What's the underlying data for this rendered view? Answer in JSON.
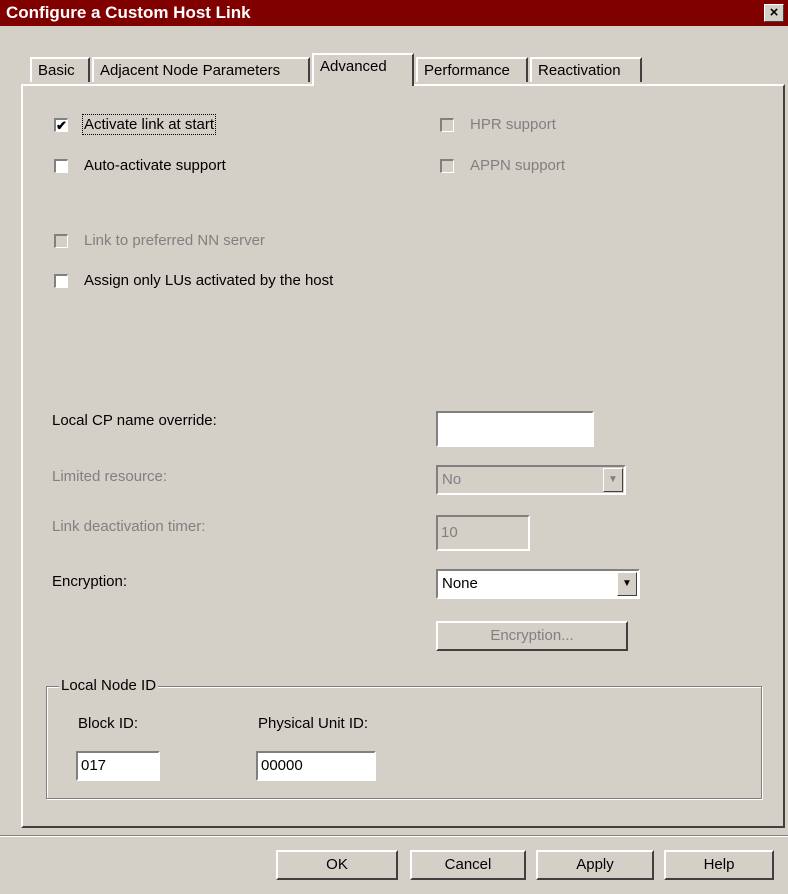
{
  "window": {
    "title": "Configure a Custom Host Link",
    "close_label": "×"
  },
  "tabs": [
    {
      "label": "Basic"
    },
    {
      "label": "Adjacent Node Parameters"
    },
    {
      "label": "Advanced"
    },
    {
      "label": "Performance"
    },
    {
      "label": "Reactivation"
    }
  ],
  "active_tab": "Advanced",
  "checkboxes": {
    "activate_link": {
      "label": "Activate link at start",
      "checked": true,
      "enabled": true
    },
    "auto_activate": {
      "label": "Auto-activate support",
      "checked": false,
      "enabled": true
    },
    "hpr": {
      "label": "HPR support",
      "checked": false,
      "enabled": false
    },
    "appn": {
      "label": "APPN support",
      "checked": false,
      "enabled": false
    },
    "link_preferred": {
      "label": "Link to preferred NN server",
      "checked": false,
      "enabled": false
    },
    "assign_lus": {
      "label": "Assign only LUs activated by the host",
      "checked": false,
      "enabled": true
    }
  },
  "fields": {
    "local_cp": {
      "label": "Local CP name override:",
      "value": ""
    },
    "limited_resource": {
      "label": "Limited resource:",
      "value": "No"
    },
    "link_deactivation": {
      "label": "Link deactivation timer:",
      "value": "10"
    },
    "encryption": {
      "label": "Encryption:",
      "value": "None"
    }
  },
  "encryption_button": "Encryption...",
  "local_node": {
    "group_label": "Local Node ID",
    "block_id_label": "Block ID:",
    "block_id_value": "017",
    "pu_id_label": "Physical Unit ID:",
    "pu_id_value": "00000"
  },
  "buttons": {
    "ok": "OK",
    "cancel": "Cancel",
    "apply": "Apply",
    "help": "Help"
  },
  "colors": {
    "titlebar": "#800000",
    "face": "#d4d0c8"
  }
}
